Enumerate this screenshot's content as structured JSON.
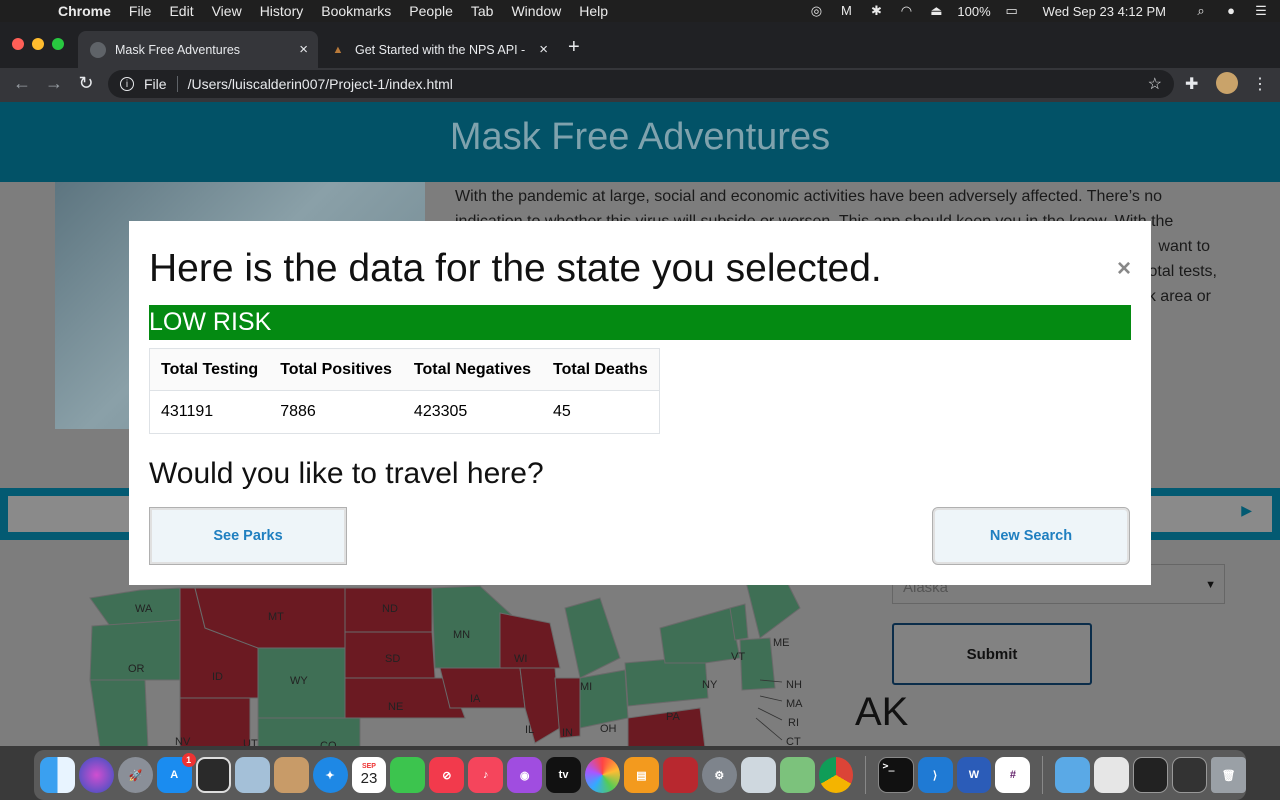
{
  "menubar": {
    "app": "Chrome",
    "items": [
      "File",
      "Edit",
      "View",
      "History",
      "Bookmarks",
      "People",
      "Tab",
      "Window",
      "Help"
    ],
    "battery": "100%",
    "datetime": "Wed Sep 23  4:12 PM"
  },
  "browser": {
    "tabs": [
      {
        "title": "Mask Free Adventures"
      },
      {
        "title": "Get Started with the NPS API -"
      }
    ],
    "address_prefix": "File",
    "address": "/Users/luiscalderin007/Project-1/index.html"
  },
  "page": {
    "title": "Mask Free Adventures",
    "intro_lines": [
      "With the pandemic at large, social and economic activities have been adversely affected. There’s no",
      "indication to whether this virus will subside or worsen. This app should keep you in the know. With the",
      "want to",
      "otal tests,",
      "k area or"
    ],
    "state_select_value": "Alaska",
    "submit_label": "Submit",
    "selected_state_abbrev": "AK",
    "map_labels": [
      "WA",
      "MT",
      "ND",
      "MN",
      "ME",
      "OR",
      "ID",
      "SD",
      "WI",
      "MI",
      "VT",
      "NY",
      "NH",
      "MA",
      "WY",
      "IA",
      "RI",
      "NE",
      "PA",
      "OH",
      "IN",
      "IL",
      "NV",
      "UT",
      "CO",
      "CT"
    ]
  },
  "modal": {
    "heading": "Here is the data for the state you selected.",
    "close_symbol": "×",
    "risk_label": "LOW RISK",
    "risk_color": "#048a12",
    "table": {
      "headers": [
        "Total Testing",
        "Total Positives",
        "Total Negatives",
        "Total Deaths"
      ],
      "row": [
        "431191",
        "7886",
        "423305",
        "45"
      ]
    },
    "travel_question": "Would you like to travel here?",
    "see_parks_label": "See Parks",
    "new_search_label": "New Search"
  },
  "dock": {
    "calendar_month": "SEP",
    "calendar_day": "23",
    "appstore_badge": "1",
    "appletv_label": "tv"
  }
}
